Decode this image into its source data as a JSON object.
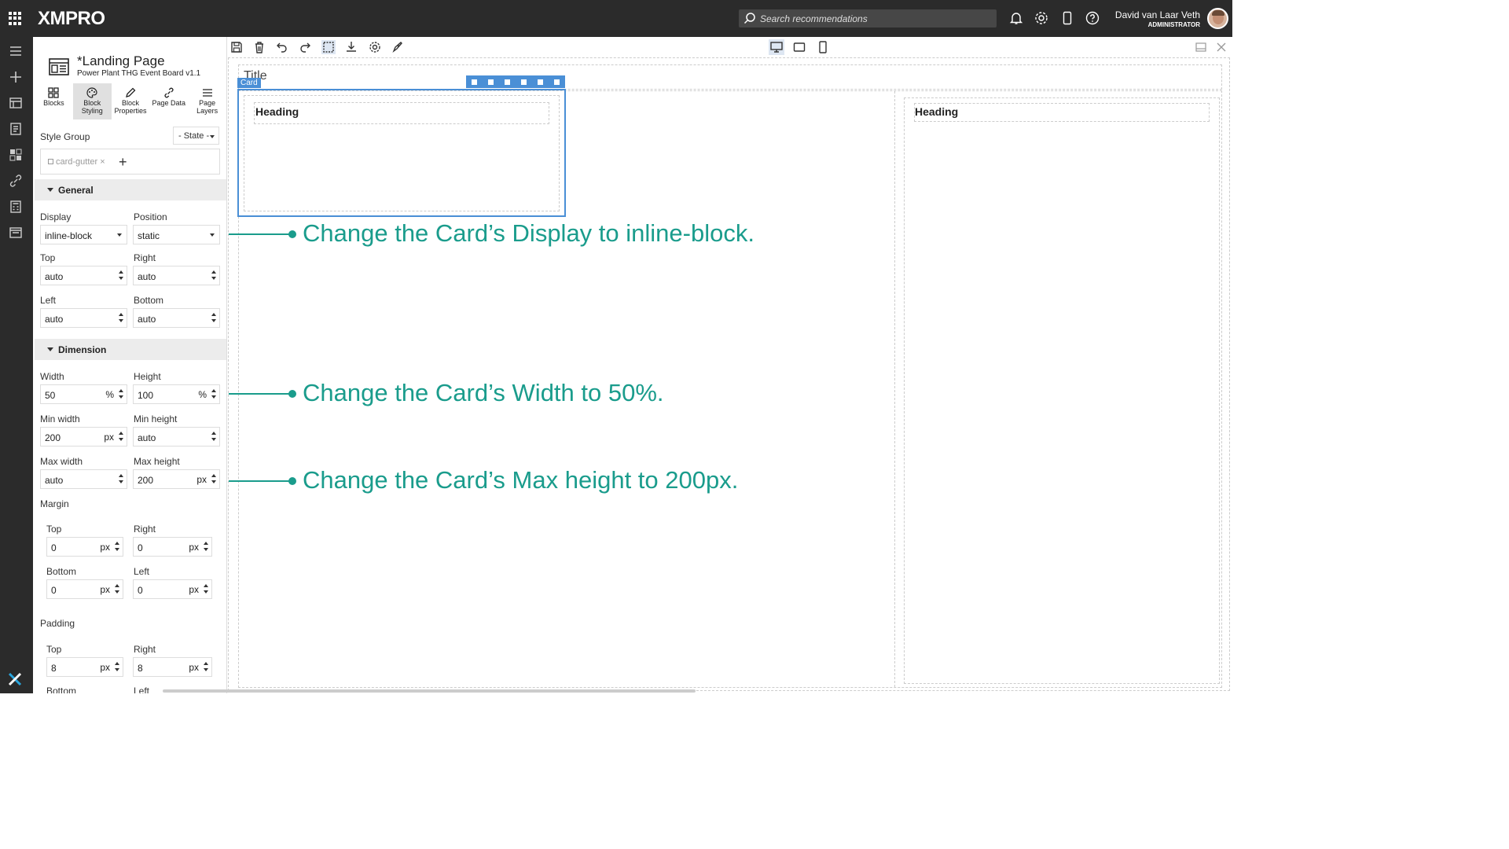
{
  "app": {
    "logo": "XMPRO",
    "search_placeholder": "Search recommendations"
  },
  "user": {
    "name": "David van Laar Veth",
    "role": "ADMINISTRATOR"
  },
  "page": {
    "title": "*Landing Page",
    "subtitle": "Power Plant THG Event Board v1.1"
  },
  "tabs": [
    {
      "label_1": "Blocks",
      "label_2": ""
    },
    {
      "label_1": "Block",
      "label_2": "Styling"
    },
    {
      "label_1": "Block",
      "label_2": "Properties"
    },
    {
      "label_1": "Page Data",
      "label_2": ""
    },
    {
      "label_1": "Page",
      "label_2": "Layers"
    }
  ],
  "style_group": {
    "label": "Style Group",
    "state": "- State -",
    "chip": "card-gutter"
  },
  "general": {
    "title": "General",
    "display_label": "Display",
    "display_value": "inline-block",
    "position_label": "Position",
    "position_value": "static",
    "top_label": "Top",
    "top_value": "auto",
    "right_label": "Right",
    "right_value": "auto",
    "left_label": "Left",
    "left_value": "auto",
    "bottom_label": "Bottom",
    "bottom_value": "auto"
  },
  "dimension": {
    "title": "Dimension",
    "width_label": "Width",
    "width_value": "50",
    "width_unit": "%",
    "height_label": "Height",
    "height_value": "100",
    "height_unit": "%",
    "min_width_label": "Min width",
    "min_width_value": "200",
    "min_width_unit": "px",
    "min_height_label": "Min height",
    "min_height_value": "auto",
    "max_width_label": "Max width",
    "max_width_value": "auto",
    "max_height_label": "Max height",
    "max_height_value": "200",
    "max_height_unit": "px"
  },
  "margin": {
    "title": "Margin",
    "top_label": "Top",
    "top_value": "0",
    "right_label": "Right",
    "right_value": "0",
    "bottom_label": "Bottom",
    "bottom_value": "0",
    "left_label": "Left",
    "left_value": "0",
    "unit": "px"
  },
  "padding": {
    "title": "Padding",
    "top_label": "Top",
    "top_value": "8",
    "right_label": "Right",
    "right_value": "8",
    "bottom_label": "Bottom",
    "left_label": "Left",
    "unit": "px"
  },
  "canvas": {
    "title": "Title",
    "card_tag": "Card",
    "heading_1": "Heading",
    "heading_2": "Heading"
  },
  "annotations": [
    "Change the Card’s Display to inline-block.",
    "Change the Card’s Width to 50%.",
    "Change the Card’s Max height to 200px."
  ],
  "colors": {
    "accent": "#1a9c8c",
    "selection": "#4a8fd6",
    "topbar": "#2b2b2b"
  }
}
